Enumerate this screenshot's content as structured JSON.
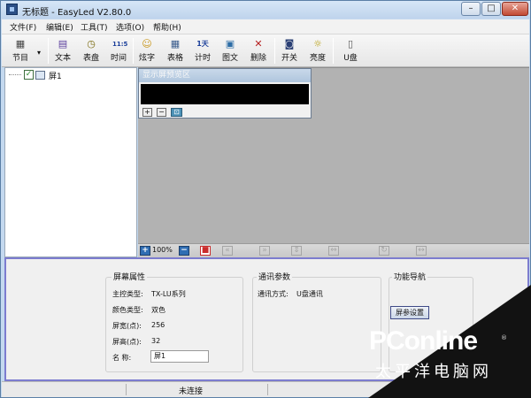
{
  "window": {
    "title": "无标题 - EasyLed V2.80.0",
    "minimize_glyph": "–",
    "maximize_glyph": "□",
    "close_glyph": "✕"
  },
  "menu": {
    "items": [
      {
        "label": "文件(F)"
      },
      {
        "label": "编辑(E)"
      },
      {
        "label": "工具(T)"
      },
      {
        "label": "选项(O)"
      },
      {
        "label": "帮助(H)"
      }
    ]
  },
  "toolbar": {
    "program": {
      "label": "节目",
      "icon": "program-icon",
      "glyph": "▦",
      "dropdown_glyph": "▾"
    },
    "text": {
      "label": "文本",
      "icon": "text-icon",
      "glyph": "▤"
    },
    "dial": {
      "label": "表盘",
      "icon": "clock-dial-icon",
      "glyph": "◷"
    },
    "time": {
      "label": "时间",
      "icon": "digital-time-icon",
      "glyph": "11:5"
    },
    "colorful": {
      "label": "炫字",
      "icon": "smiley-icon",
      "glyph": "☺"
    },
    "table": {
      "label": "表格",
      "icon": "table-icon",
      "glyph": "▦"
    },
    "timer": {
      "label": "计时",
      "icon": "countdown-icon",
      "glyph": "1天"
    },
    "picture": {
      "label": "图文",
      "icon": "picture-icon",
      "glyph": "▣"
    },
    "delete": {
      "label": "删除",
      "icon": "delete-icon",
      "glyph": "✕"
    },
    "power": {
      "label": "开关",
      "icon": "power-switch-icon",
      "glyph": "◙"
    },
    "brightness": {
      "label": "亮度",
      "icon": "bulb-icon",
      "glyph": "☼"
    },
    "usb": {
      "label": "U盘",
      "icon": "usb-drive-icon",
      "glyph": "▯"
    }
  },
  "tree": {
    "screen_label": "屏1",
    "checked": true,
    "check_glyph": "✓"
  },
  "preview": {
    "title": "显示屏预览区",
    "zoom_in_glyph": "+",
    "zoom_out_glyph": "−",
    "fit_glyph": "⊡"
  },
  "zoombar": {
    "zoom_in_glyph": "+",
    "zoom_level": "100%",
    "zoom_out_glyph": "−",
    "stop_glyph": "■",
    "prev_glyph": "«",
    "next_glyph": "»",
    "vert_glyph": "⇕",
    "horiz_glyph": "⇔",
    "rotate_glyph": "↻",
    "expand_glyph": "↔"
  },
  "screen_props": {
    "title": "屏幕属性",
    "controller_label": "主控类型:",
    "controller_value": "TX-LU系列",
    "color_label": "颜色类型:",
    "color_value": "双色",
    "width_label": "屏宽(点):",
    "width_value": "256",
    "height_label": "屏高(点):",
    "height_value": "32",
    "name_label": "名    称:",
    "name_value": "屏1"
  },
  "comm": {
    "title": "通讯参数",
    "mode_label": "通讯方式:",
    "mode_value": "U盘通讯"
  },
  "nav": {
    "title": "功能导航",
    "button_label": "屏参设置"
  },
  "status": {
    "text": "未连接"
  },
  "watermark": {
    "brand": "PConline",
    "reg": "®",
    "subtitle": "太平洋电脑网"
  },
  "colors": {
    "stage_gray": "#b2b2b2",
    "panel_border": "#7c7ccf",
    "titlebar_blue": "#c4d9ef"
  }
}
